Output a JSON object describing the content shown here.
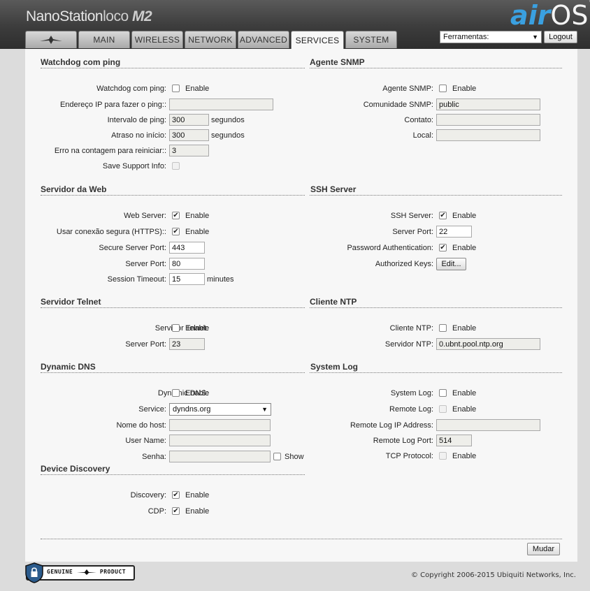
{
  "header": {
    "brand": "NanoStation",
    "brand_model": "loco",
    "brand_suffix": "M2",
    "logo_air": "air",
    "logo_os": "OS",
    "logo_tm": "™"
  },
  "tabs": [
    {
      "label": "",
      "icon": "ubiquiti-logo-icon"
    },
    {
      "label": "MAIN"
    },
    {
      "label": "WIRELESS"
    },
    {
      "label": "NETWORK"
    },
    {
      "label": "ADVANCED"
    },
    {
      "label": "SERVICES",
      "active": true
    },
    {
      "label": "SYSTEM"
    }
  ],
  "tools": {
    "selected": "Ferramentas:",
    "logout": "Logout"
  },
  "watchdog": {
    "title": "Watchdog com ping",
    "enable_label": "Watchdog com ping:",
    "enable_text": "Enable",
    "enabled": false,
    "ip_label": "Endereço IP para fazer o ping::",
    "ip_value": "",
    "interval_label": "Intervalo de ping:",
    "interval_value": "300",
    "interval_unit": "segundos",
    "delay_label": "Atraso no início:",
    "delay_value": "300",
    "delay_unit": "segundos",
    "fail_label": "Erro na contagem para reiniciar::",
    "fail_value": "3",
    "support_label": "Save Support Info:"
  },
  "snmp": {
    "title": "Agente SNMP",
    "enable_label": "Agente SNMP:",
    "enable_text": "Enable",
    "enabled": false,
    "community_label": "Comunidade SNMP:",
    "community_value": "public",
    "contact_label": "Contato:",
    "contact_value": "",
    "location_label": "Local:",
    "location_value": ""
  },
  "web": {
    "title": "Servidor da Web",
    "server_label": "Web Server:",
    "server_text": "Enable",
    "server_enabled": true,
    "https_label": "Usar conexão segura (HTTPS)::",
    "https_text": "Enable",
    "https_enabled": true,
    "secure_port_label": "Secure Server Port:",
    "secure_port_value": "443",
    "port_label": "Server Port:",
    "port_value": "80",
    "timeout_label": "Session Timeout:",
    "timeout_value": "15",
    "timeout_unit": "minutes"
  },
  "ssh": {
    "title": "SSH Server",
    "server_label": "SSH Server:",
    "server_text": "Enable",
    "server_enabled": true,
    "port_label": "Server Port:",
    "port_value": "22",
    "password_label": "Password Authentication:",
    "password_text": "Enable",
    "password_enabled": true,
    "keys_label": "Authorized Keys:",
    "keys_button": "Edit..."
  },
  "telnet": {
    "title": "Servidor Telnet",
    "server_label": "Servidor Telnet:",
    "server_text": "Enable",
    "server_enabled": false,
    "port_label": "Server Port:",
    "port_value": "23"
  },
  "ntp": {
    "title": "Cliente NTP",
    "client_label": "Cliente NTP:",
    "client_text": "Enable",
    "client_enabled": false,
    "server_label": "Servidor NTP:",
    "server_value": "0.ubnt.pool.ntp.org"
  },
  "ddns": {
    "title": "Dynamic DNS",
    "enable_label": "Dynamic DNS:",
    "enable_text": "Enable",
    "enabled": false,
    "service_label": "Service:",
    "service_value": "dyndns.org",
    "host_label": "Nome do host:",
    "host_value": "",
    "user_label": "User Name:",
    "user_value": "",
    "password_label": "Senha:",
    "password_value": "",
    "show_text": "Show"
  },
  "syslog": {
    "title": "System Log",
    "enable_label": "System Log:",
    "enable_text": "Enable",
    "enabled": false,
    "remote_label": "Remote Log:",
    "remote_text": "Enable",
    "remote_ip_label": "Remote Log IP Address:",
    "remote_ip_value": "",
    "remote_port_label": "Remote Log Port:",
    "remote_port_value": "514",
    "tcp_label": "TCP Protocol:",
    "tcp_text": "Enable"
  },
  "discovery": {
    "title": "Device Discovery",
    "discovery_label": "Discovery:",
    "discovery_text": "Enable",
    "discovery_enabled": true,
    "cdp_label": "CDP:",
    "cdp_text": "Enable",
    "cdp_enabled": true
  },
  "actions": {
    "apply": "Mudar"
  },
  "footer": {
    "badge_text": "GENUINE",
    "badge_text2": "PRODUCT",
    "copyright": "© Copyright 2006-2015 Ubiquiti Networks, Inc."
  }
}
